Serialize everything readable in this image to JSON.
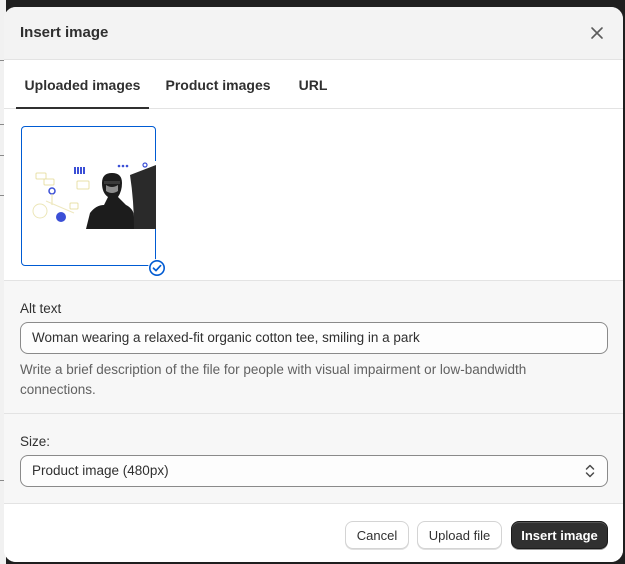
{
  "modal": {
    "title": "Insert image"
  },
  "tabs": [
    {
      "label": "Uploaded images",
      "active": true
    },
    {
      "label": "Product images",
      "active": false
    },
    {
      "label": "URL",
      "active": false
    }
  ],
  "gallery": {
    "selected_count": 1
  },
  "alt_text": {
    "label": "Alt text",
    "value": "Woman wearing a relaxed-fit organic cotton tee, smiling in a park",
    "help": "Write a brief description of the file for people with visual impairment or low-bandwidth connections."
  },
  "size": {
    "label": "Size:",
    "selected": "Product image (480px)"
  },
  "footer": {
    "cancel_label": "Cancel",
    "upload_label": "Upload file",
    "insert_label": "Insert image"
  },
  "colors": {
    "selection_blue": "#005bd3",
    "primary_button": "#303030",
    "header_bg": "#f3f3f3",
    "section_bg": "#f7f7f7"
  },
  "icons": [
    "close-icon",
    "checkmark-circle-icon",
    "select-chevron-icon"
  ]
}
